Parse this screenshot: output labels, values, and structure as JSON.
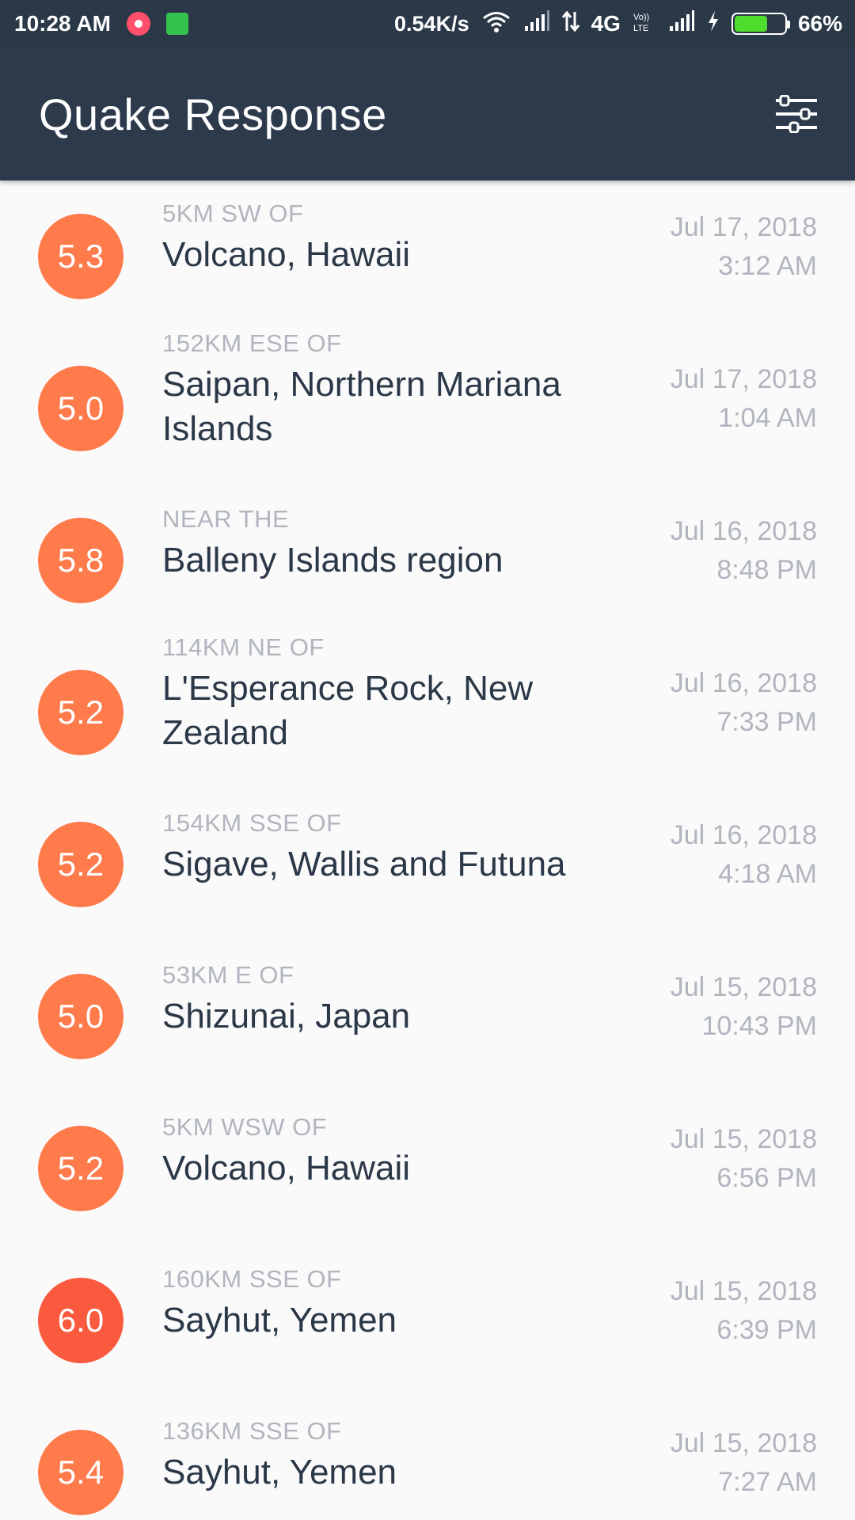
{
  "status_bar": {
    "time": "10:28 AM",
    "speed": "0.54K/s",
    "network": "4G",
    "battery_pct": "66%",
    "battery_level": 0.66,
    "icons": [
      "music-app-icon",
      "android-icon",
      "wifi-icon",
      "signal-icon",
      "data-arrows-icon",
      "volte-icon",
      "signal-icon",
      "charging-icon",
      "battery-icon"
    ]
  },
  "app_bar": {
    "title": "Quake Response",
    "filter_icon": "sliders-icon"
  },
  "colors": {
    "status_bar": "#2b3848",
    "app_bar": "#2c3a4c",
    "background": "#fafafa",
    "primary_text": "#2b3848",
    "secondary_text": "#b1b5bd",
    "mag_5_0_to_5_9": "#ff7b4c",
    "mag_6_0_plus": "#fa5a3e"
  },
  "quakes": [
    {
      "mag": "5.3",
      "offset": "5KM SW OF",
      "location": "Volcano, Hawaii",
      "date": "Jul 17, 2018",
      "time": "3:12 AM",
      "color": "#ff7b4c"
    },
    {
      "mag": "5.0",
      "offset": "152KM ESE OF",
      "location": "Saipan, Northern Mariana Islands",
      "date": "Jul 17, 2018",
      "time": "1:04 AM",
      "color": "#ff7b4c"
    },
    {
      "mag": "5.8",
      "offset": "NEAR THE",
      "location": "Balleny Islands region",
      "date": "Jul 16, 2018",
      "time": "8:48 PM",
      "color": "#ff7b4c"
    },
    {
      "mag": "5.2",
      "offset": "114KM NE OF",
      "location": "L'Esperance Rock, New Zealand",
      "date": "Jul 16, 2018",
      "time": "7:33 PM",
      "color": "#ff7b4c"
    },
    {
      "mag": "5.2",
      "offset": "154KM SSE OF",
      "location": "Sigave, Wallis and Futuna",
      "date": "Jul 16, 2018",
      "time": "4:18 AM",
      "color": "#ff7b4c"
    },
    {
      "mag": "5.0",
      "offset": "53KM E OF",
      "location": "Shizunai, Japan",
      "date": "Jul 15, 2018",
      "time": "10:43 PM",
      "color": "#ff7b4c"
    },
    {
      "mag": "5.2",
      "offset": "5KM WSW OF",
      "location": "Volcano, Hawaii",
      "date": "Jul 15, 2018",
      "time": "6:56 PM",
      "color": "#ff7b4c"
    },
    {
      "mag": "6.0",
      "offset": "160KM SSE OF",
      "location": "Sayhut, Yemen",
      "date": "Jul 15, 2018",
      "time": "6:39 PM",
      "color": "#fa5a3e"
    },
    {
      "mag": "5.4",
      "offset": "136KM SSE OF",
      "location": "Sayhut, Yemen",
      "date": "Jul 15, 2018",
      "time": "7:27 AM",
      "color": "#ff7b4c"
    }
  ]
}
